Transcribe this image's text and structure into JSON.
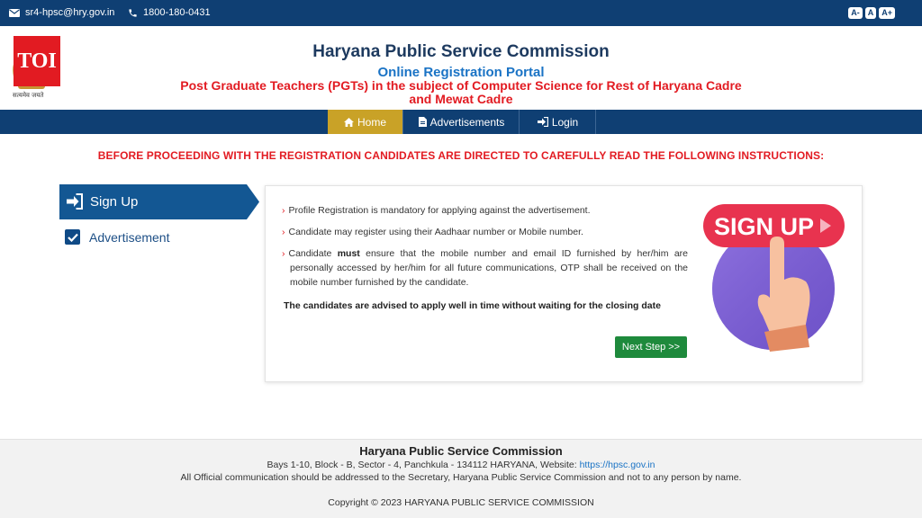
{
  "topbar": {
    "email": "sr4-hpsc@hry.gov.in",
    "phone": "1800-180-0431",
    "font_sizes": [
      "A-",
      "A",
      "A+"
    ]
  },
  "header": {
    "logo_badge": "TOI",
    "emblem_caption": "सत्यमेव जयते",
    "title": "Haryana Public Service Commission",
    "portal": "Online Registration Portal",
    "subtitle_line1": "Post Graduate Teachers (PGTs) in the subject of Computer Science for Rest of Haryana Cadre",
    "subtitle_line2": "and Mewat Cadre"
  },
  "nav": {
    "home": "Home",
    "advertisements": "Advertisements",
    "login": "Login"
  },
  "notice": "BEFORE PROCEEDING WITH THE REGISTRATION CANDIDATES ARE DIRECTED TO CAREFULLY READ THE FOLLOWING INSTRUCTIONS:",
  "sidebar": {
    "signup": "Sign Up",
    "advertisement": "Advertisement"
  },
  "card": {
    "instructions": [
      "Profile Registration is mandatory for applying against the advertisement.",
      "Candidate may register using their Aadhaar number or Mobile number."
    ],
    "instr3_pre": "Candidate ",
    "instr3_bold": "must",
    "instr3_post": " ensure that the mobile number and email ID furnished by her/him are personally accessed by her/him for all future communications, OTP shall be received on the mobile number furnished by the candidate.",
    "advise": "The candidates are advised to apply well in time without waiting for the closing date",
    "next_button": "Next Step >>",
    "illustration_text": "SIGN UP"
  },
  "footer": {
    "title": "Haryana Public Service Commission",
    "address": "Bays 1-10, Block - B, Sector - 4, Panchkula - 134112 HARYANA, Website: ",
    "website": "https://hpsc.gov.in",
    "note": "All Official communication should be addressed to the Secretary, Haryana Public Service Commission and not to any person by name.",
    "copyright": "Copyright © 2023 HARYANA PUBLIC SERVICE COMMISSION"
  },
  "colors": {
    "primary": "#0f3f73",
    "accent_red": "#e21b22",
    "nav_active": "#c9a227",
    "button_green": "#1e8a3c"
  }
}
